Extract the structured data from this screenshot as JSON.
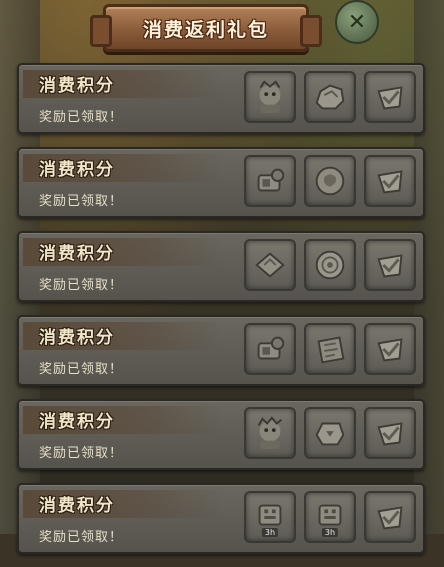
{
  "title": "消费返利礼包",
  "rows": [
    {
      "name": "消费积分",
      "status": "奖励已领取！",
      "rewards": [
        "hero-portrait-icon",
        "ore-chunk-icon",
        "claimed-check-icon"
      ]
    },
    {
      "name": "消费积分",
      "status": "奖励已领取！",
      "rewards": [
        "crafting-kit-icon",
        "ancient-coin-icon",
        "claimed-check-icon"
      ]
    },
    {
      "name": "消费积分",
      "status": "奖励已领取！",
      "rewards": [
        "scroll-tile-icon",
        "round-token-icon",
        "claimed-check-icon"
      ]
    },
    {
      "name": "消费积分",
      "status": "奖励已领取！",
      "rewards": [
        "crafting-kit-icon",
        "carved-rune-icon",
        "claimed-check-icon"
      ]
    },
    {
      "name": "消费积分",
      "status": "奖励已领取！",
      "rewards": [
        "hero-portrait-icon",
        "stone-tablet-icon",
        "claimed-check-icon"
      ]
    },
    {
      "name": "消费积分",
      "status": "奖励已领取！",
      "rewards": [
        "time-chest-icon",
        "time-chest-icon",
        "claimed-check-icon"
      ],
      "badges": [
        "3h",
        "3h",
        ""
      ]
    }
  ]
}
